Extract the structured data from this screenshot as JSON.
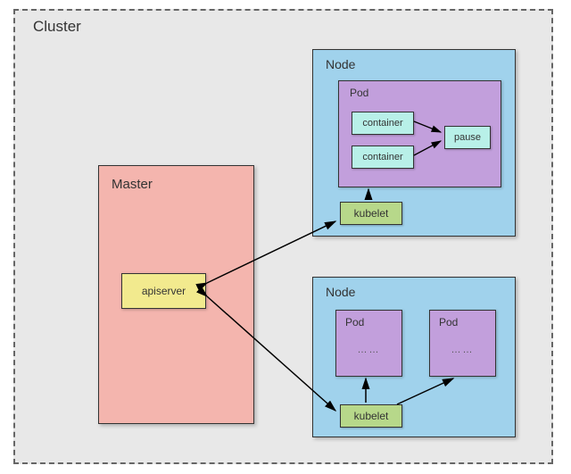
{
  "cluster": {
    "label": "Cluster"
  },
  "master": {
    "label": "Master",
    "apiserver": "apiserver"
  },
  "node1": {
    "label": "Node",
    "pod": {
      "label": "Pod",
      "container1": "container",
      "container2": "container",
      "pause": "pause"
    },
    "kubelet": "kubelet"
  },
  "node2": {
    "label": "Node",
    "pod1": {
      "label": "Pod",
      "ellipsis": "……"
    },
    "pod2": {
      "label": "Pod",
      "ellipsis": "……"
    },
    "kubelet": "kubelet"
  }
}
